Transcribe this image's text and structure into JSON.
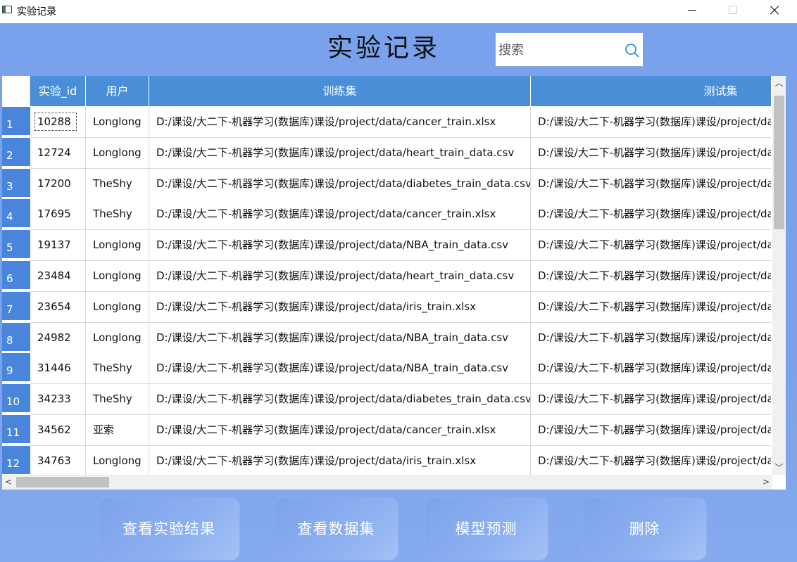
{
  "window": {
    "title": "实验记录"
  },
  "page": {
    "title": "实验记录"
  },
  "search": {
    "placeholder": "搜索"
  },
  "table": {
    "columns": [
      "实验_id",
      "用户",
      "训练集",
      "测试集"
    ],
    "rows": [
      {
        "num": "1",
        "id": "10288",
        "user": "Longlong",
        "train": "D:/课设/大二下-机器学习(数据库)课设/project/data/cancer_train.xlsx",
        "test": "D:/课设/大二下-机器学习(数据库)课设/project/da"
      },
      {
        "num": "2",
        "id": "12724",
        "user": "Longlong",
        "train": "D:/课设/大二下-机器学习(数据库)课设/project/data/heart_train_data.csv",
        "test": "D:/课设/大二下-机器学习(数据库)课设/project/da"
      },
      {
        "num": "3",
        "id": "17200",
        "user": "TheShy",
        "train": "D:/课设/大二下-机器学习(数据库)课设/project/data/diabetes_train_data.csv",
        "test": "D:/课设/大二下-机器学习(数据库)课设/project/da"
      },
      {
        "num": "4",
        "id": "17695",
        "user": "TheShy",
        "train": "D:/课设/大二下-机器学习(数据库)课设/project/data/cancer_train.xlsx",
        "test": "D:/课设/大二下-机器学习(数据库)课设/project/da"
      },
      {
        "num": "5",
        "id": "19137",
        "user": "Longlong",
        "train": "D:/课设/大二下-机器学习(数据库)课设/project/data/NBA_train_data.csv",
        "test": "D:/课设/大二下-机器学习(数据库)课设/project/da"
      },
      {
        "num": "6",
        "id": "23484",
        "user": "Longlong",
        "train": "D:/课设/大二下-机器学习(数据库)课设/project/data/heart_train_data.csv",
        "test": "D:/课设/大二下-机器学习(数据库)课设/project/da"
      },
      {
        "num": "7",
        "id": "23654",
        "user": "Longlong",
        "train": "D:/课设/大二下-机器学习(数据库)课设/project/data/iris_train.xlsx",
        "test": "D:/课设/大二下-机器学习(数据库)课设/project/da"
      },
      {
        "num": "8",
        "id": "24982",
        "user": "Longlong",
        "train": "D:/课设/大二下-机器学习(数据库)课设/project/data/NBA_train_data.csv",
        "test": "D:/课设/大二下-机器学习(数据库)课设/project/da"
      },
      {
        "num": "9",
        "id": "31446",
        "user": "TheShy",
        "train": "D:/课设/大二下-机器学习(数据库)课设/project/data/NBA_train_data.csv",
        "test": "D:/课设/大二下-机器学习(数据库)课设/project/da"
      },
      {
        "num": "10",
        "id": "34233",
        "user": "TheShy",
        "train": "D:/课设/大二下-机器学习(数据库)课设/project/data/diabetes_train_data.csv",
        "test": "D:/课设/大二下-机器学习(数据库)课设/project/da"
      },
      {
        "num": "11",
        "id": "34562",
        "user": "亚索",
        "train": "D:/课设/大二下-机器学习(数据库)课设/project/data/cancer_train.xlsx",
        "test": "D:/课设/大二下-机器学习(数据库)课设/project/da"
      },
      {
        "num": "12",
        "id": "34763",
        "user": "Longlong",
        "train": "D:/课设/大二下-机器学习(数据库)课设/project/data/iris_train.xlsx",
        "test": "D:/课设/大二下-机器学习(数据库)课设/project/da"
      }
    ]
  },
  "buttons": {
    "view_result": "查看实验结果",
    "view_dataset": "查看数据集",
    "predict": "模型预测",
    "delete": "删除"
  },
  "colors": {
    "accent": "#4a8ed8",
    "background": "#7aa2ec"
  }
}
